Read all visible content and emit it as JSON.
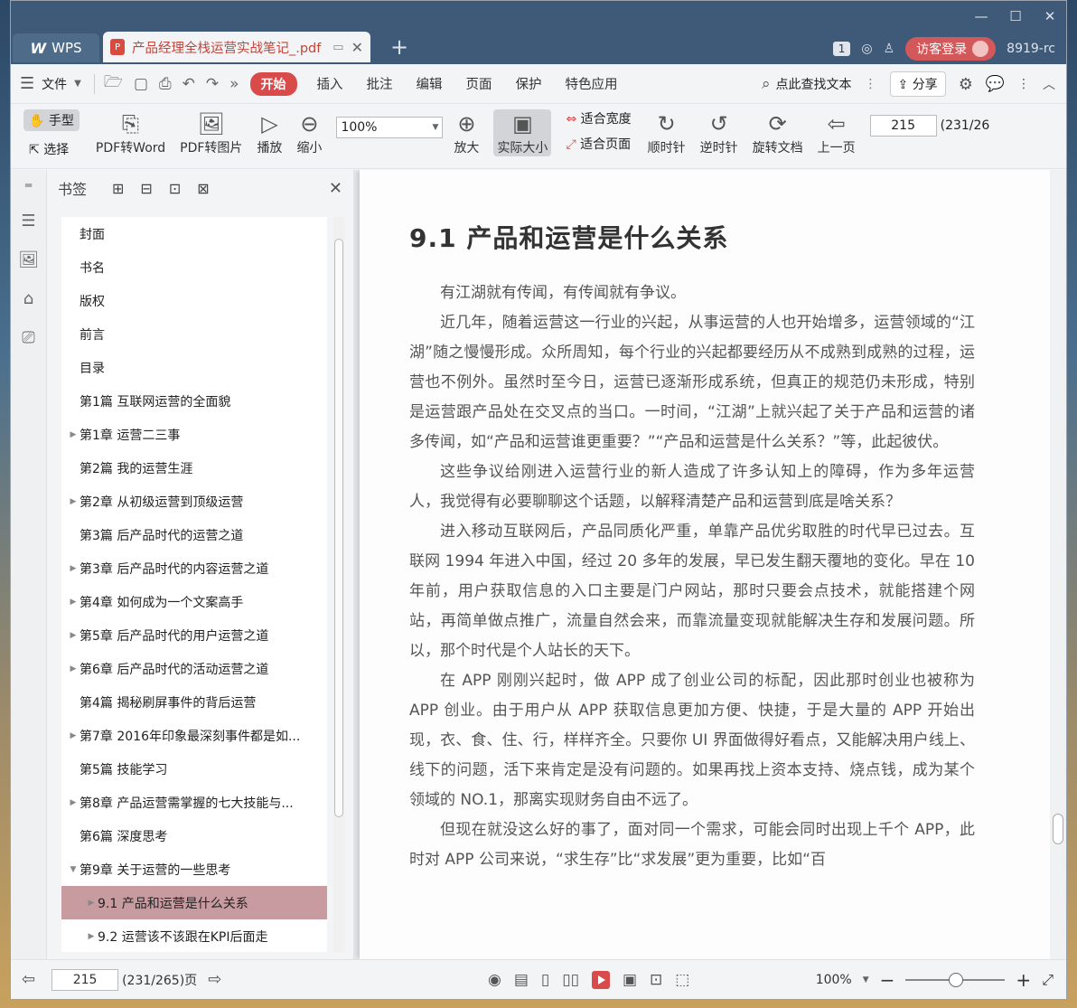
{
  "window": {
    "min": "—",
    "max": "☐",
    "close": "✕"
  },
  "tabs": {
    "wps_label": "WPS",
    "doc_title": "产品经理全栈运营实战笔记_.pdf",
    "add": "+"
  },
  "titlebar_right": {
    "badge": "1",
    "visitor_login": "访客登录",
    "user_id": "8919-rc"
  },
  "menu": {
    "file": "文件",
    "items": [
      "开始",
      "插入",
      "批注",
      "编辑",
      "页面",
      "保护",
      "特色应用"
    ],
    "search": "点此查找文本",
    "share": "分享"
  },
  "toolbar": {
    "hand": "手型",
    "select": "选择",
    "pdf_to_word": "PDF转Word",
    "pdf_to_image": "PDF转图片",
    "play": "播放",
    "zoom_out": "缩小",
    "zoom_value": "100%",
    "zoom_in": "放大",
    "actual_size": "实际大小",
    "fit_width": "适合宽度",
    "fit_page": "适合页面",
    "clockwise": "顺时针",
    "counterclockwise": "逆时针",
    "rotate_doc": "旋转文档",
    "prev_page": "上一页",
    "page_value": "215",
    "page_count": "(231/26"
  },
  "bookmarks": {
    "title": "书签",
    "items": [
      {
        "label": "封面",
        "arrow": ""
      },
      {
        "label": "书名",
        "arrow": ""
      },
      {
        "label": "版权",
        "arrow": ""
      },
      {
        "label": "前言",
        "arrow": ""
      },
      {
        "label": "目录",
        "arrow": ""
      },
      {
        "label": "第1篇  互联网运营的全面貌",
        "arrow": ""
      },
      {
        "label": "第1章  运营二三事",
        "arrow": "▶"
      },
      {
        "label": "第2篇  我的运营生涯",
        "arrow": ""
      },
      {
        "label": "第2章  从初级运营到顶级运营",
        "arrow": "▶"
      },
      {
        "label": "第3篇  后产品时代的运营之道",
        "arrow": ""
      },
      {
        "label": "第3章  后产品时代的内容运营之道",
        "arrow": "▶"
      },
      {
        "label": "第4章  如何成为一个文案高手",
        "arrow": "▶"
      },
      {
        "label": "第5章  后产品时代的用户运营之道",
        "arrow": "▶"
      },
      {
        "label": "第6章  后产品时代的活动运营之道",
        "arrow": "▶"
      },
      {
        "label": "第4篇  揭秘刷屏事件的背后运营",
        "arrow": ""
      },
      {
        "label": "第7章  2016年印象最深刻事件都是如...",
        "arrow": "▶"
      },
      {
        "label": "第5篇  技能学习",
        "arrow": ""
      },
      {
        "label": "第8章  产品运营需掌握的七大技能与...",
        "arrow": "▶"
      },
      {
        "label": "第6篇  深度思考",
        "arrow": ""
      },
      {
        "label": "第9章  关于运营的一些思考",
        "arrow": "▼"
      },
      {
        "label": "9.1  产品和运营是什么关系",
        "arrow": "▶"
      },
      {
        "label": "9.2  运营该不该跟在KPI后面走",
        "arrow": "▶"
      }
    ]
  },
  "document": {
    "heading": "9.1   产品和运营是什么关系",
    "paragraphs": [
      "有江湖就有传闻，有传闻就有争议。",
      "近几年，随着运营这一行业的兴起，从事运营的人也开始增多，运营领域的“江湖”随之慢慢形成。众所周知，每个行业的兴起都要经历从不成熟到成熟的过程，运营也不例外。虽然时至今日，运营已逐渐形成系统，但真正的规范仍未形成，特别是运营跟产品处在交叉点的当口。一时间，“江湖”上就兴起了关于产品和运营的诸多传闻，如“产品和运营谁更重要？”“产品和运营是什么关系？”等，此起彼伏。",
      "这些争议给刚进入运营行业的新人造成了许多认知上的障碍，作为多年运营人，我觉得有必要聊聊这个话题，以解释清楚产品和运营到底是啥关系？",
      "进入移动互联网后，产品同质化严重，单靠产品优劣取胜的时代早已过去。互联网 1994 年进入中国，经过 20 多年的发展，早已发生翻天覆地的变化。早在 10 年前，用户获取信息的入口主要是门户网站，那时只要会点技术，就能搭建个网站，再简单做点推广，流量自然会来，而靠流量变现就能解决生存和发展问题。所以，那个时代是个人站长的天下。",
      "在 APP 刚刚兴起时，做 APP 成了创业公司的标配，因此那时创业也被称为 APP 创业。由于用户从 APP 获取信息更加方便、快捷，于是大量的 APP 开始出现，衣、食、住、行，样样齐全。只要你 UI 界面做得好看点，又能解决用户线上、线下的问题，活下来肯定是没有问题的。如果再找上资本支持、烧点钱，成为某个领域的 NO.1，那离实现财务自由不远了。",
      "但现在就没这么好的事了，面对同一个需求，可能会同时出现上千个 APP，此时对 APP 公司来说，“求生存”比“求发展”更为重要，比如“百"
    ]
  },
  "status": {
    "page_value": "215",
    "page_count": "(231/265)页",
    "zoom": "100%"
  }
}
